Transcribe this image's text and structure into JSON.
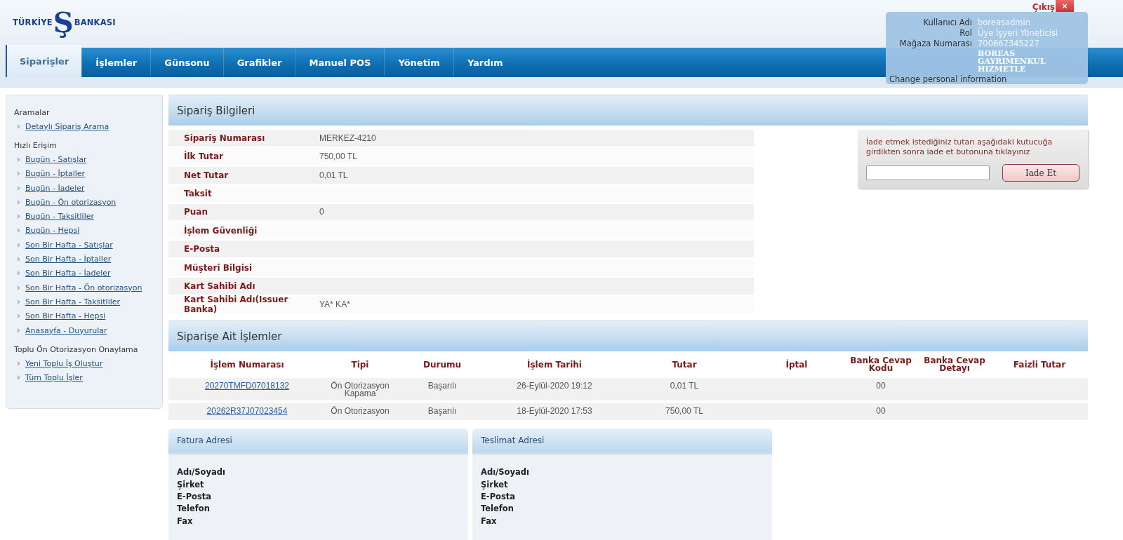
{
  "header": {
    "logo": {
      "left": "TÜRKİYE",
      "mark": "Ş",
      "right": "BANKASI"
    },
    "logout": "Çıkış",
    "close": "×"
  },
  "nav": [
    {
      "label": "Siparişler",
      "selected": true
    },
    {
      "label": "İşlemler",
      "selected": false
    },
    {
      "label": "Günsonu",
      "selected": false
    },
    {
      "label": "Grafikler",
      "selected": false
    },
    {
      "label": "Manuel POS",
      "selected": false
    },
    {
      "label": "Yönetim",
      "selected": false
    },
    {
      "label": "Yardım",
      "selected": false
    }
  ],
  "user_panel": {
    "fields": [
      {
        "label": "Kullanıcı Adı",
        "value": "boreasadmin"
      },
      {
        "label": "Rol",
        "value": "Üye İşyeri Yöneticisi"
      },
      {
        "label": "Mağaza Numarası",
        "value": "700667345227"
      }
    ],
    "company": "BOREAS GAYRIMENKUL HIZMETLE",
    "link": "Change personal information"
  },
  "sidebar": {
    "sections": [
      {
        "title": "Aramalar",
        "items": [
          "Detaylı Sipariş Arama"
        ]
      },
      {
        "title": "Hızlı Erişim",
        "items": [
          "Bugün - Satışlar",
          "Bugün - İptaller",
          "Bugün - İadeler",
          "Bugün - Ön otorizasyon",
          "Bugün - Taksitliler",
          "Bugün - Hepsi",
          "Son Bir Hafta - Satışlar",
          "Son Bir Hafta - İptaller",
          "Son Bir Hafta - İadeler",
          "Son Bir Hafta - Ön otorizasyon",
          "Son Bir Hafta - Taksitliler",
          "Son Bir Hafta - Hepsi",
          "Anasayfa - Duyurular"
        ]
      },
      {
        "title": "Toplu Ön Otorizasyon Onaylama",
        "items": [
          "Yeni Toplu İş Oluştur",
          "Tüm Toplu İşler"
        ]
      }
    ]
  },
  "order_info": {
    "title": "Sipariş Bilgileri",
    "rows": [
      {
        "label": "Sipariş Numarası",
        "value": "MERKEZ-4210"
      },
      {
        "label": "İlk Tutar",
        "value": "750,00 TL"
      },
      {
        "label": "Net Tutar",
        "value": "0,01 TL"
      },
      {
        "label": "Taksit"
      },
      {
        "label": "Puan",
        "value": "0"
      },
      {
        "label": "İşlem Güvenliği"
      },
      {
        "label": "E-Posta"
      },
      {
        "label": "Müşteri Bilgisi"
      },
      {
        "label": "Kart Sahibi Adı"
      },
      {
        "label": "Kart Sahibi Adı(Issuer Banka)",
        "value": "YA* KA*"
      }
    ]
  },
  "refund": {
    "note": "İade etmek istediğiniz tutarı aşağıdaki kutucuğa girdikten sonra iade et butonuna tıklayınız",
    "button": "Iade Et"
  },
  "transactions": {
    "title": "Siparişe Ait İşlemler",
    "columns": [
      "İşlem Numarası",
      "Tipi",
      "Durumu",
      "İşlem Tarihi",
      "Tutar",
      "İptal",
      "Banka Cevap Kodu",
      "Banka Cevap Detayı",
      "Faizli Tutar"
    ],
    "rows": [
      {
        "number": "20270TMFD07018132",
        "type": "Ön Otorizasyon Kapama",
        "status": "Başarılı",
        "date": "26-Eylül-2020 19:12",
        "amount": "0,01 TL",
        "response_code": "00"
      },
      {
        "number": "20262R37J07023454",
        "type": "Ön Otorizasyon",
        "status": "Başarılı",
        "date": "18-Eylül-2020 17:53",
        "amount": "750,00 TL",
        "response_code": "00"
      }
    ]
  },
  "addresses": [
    {
      "title": "Fatura Adresi",
      "fields": [
        "Adı/Soyadı",
        "Şirket",
        "E-Posta",
        "Telefon",
        "Fax"
      ]
    },
    {
      "title": "Teslimat Adresi",
      "fields": [
        "Adı/Soyadı",
        "Şirket",
        "E-Posta",
        "Telefon",
        "Fax"
      ]
    }
  ]
}
